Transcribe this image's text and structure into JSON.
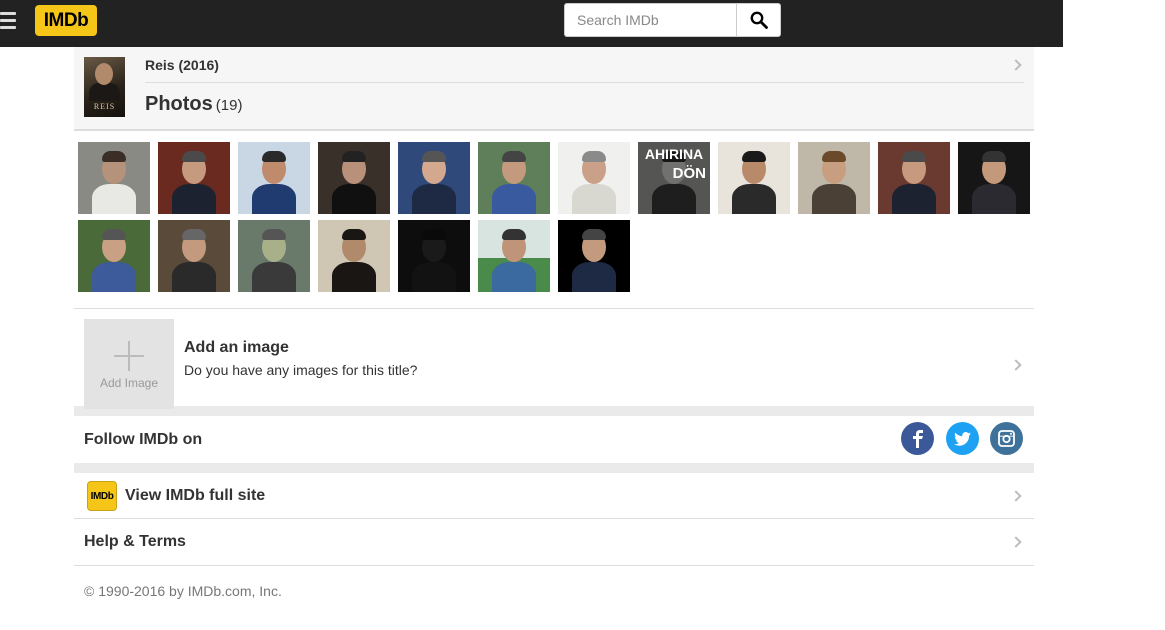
{
  "header": {
    "logo_text": "IMDb",
    "search_placeholder": "Search IMDb",
    "menu_icon": "hamburger-menu-icon",
    "search_icon": "search-icon"
  },
  "title": {
    "name": "Reis (2016)",
    "section": "Photos",
    "count": "(19)",
    "poster_text": "REIS"
  },
  "photos": [
    {
      "bg": "#8a8a85",
      "skin": "#b5927a",
      "cloth": "#e8e8e4",
      "hair": "#3a2e26"
    },
    {
      "bg": "#6a2a20",
      "skin": "#c59a7e",
      "cloth": "#1d2230",
      "hair": "#4a4a4a"
    },
    {
      "bg": "#c9d6e4",
      "skin": "#c08a6c",
      "cloth": "#1f3b70",
      "hair": "#2a2a2a"
    },
    {
      "bg": "#3a302a",
      "skin": "#b9907a",
      "cloth": "#101010",
      "hair": "#222222"
    },
    {
      "bg": "#2f4a7a",
      "skin": "#d3a88e",
      "cloth": "#1e2a44",
      "hair": "#555555"
    },
    {
      "bg": "#5f7f5a",
      "skin": "#c49a7e",
      "cloth": "#3a5aa0",
      "hair": "#444444"
    },
    {
      "bg": "#f0f0ee",
      "skin": "#caa088",
      "cloth": "#d8d8d0",
      "hair": "#8a8a8a"
    },
    {
      "bg": "#9a9a98",
      "skin": "#d8d8d6",
      "cloth": "#202020",
      "hair": "#111111",
      "text": "AHIRINA DÖN"
    },
    {
      "bg": "#e8e4dc",
      "skin": "#b88a6a",
      "cloth": "#2a2a2a",
      "hair": "#1a1a1a"
    },
    {
      "bg": "#bfb8a8",
      "skin": "#c89e80",
      "cloth": "#4a4036",
      "hair": "#6a4a2a"
    },
    {
      "bg": "#6a3a30",
      "skin": "#c59a7e",
      "cloth": "#1d2230",
      "hair": "#4a4a4a"
    },
    {
      "bg": "#161616",
      "skin": "#c4987a",
      "cloth": "#2a2a30",
      "hair": "#333333"
    },
    {
      "bg": "#4a6a3a",
      "skin": "#c9a084",
      "cloth": "#3d5a9a",
      "hair": "#555555"
    },
    {
      "bg": "#5a4a3a",
      "skin": "#c49a7e",
      "cloth": "#2a2a2a",
      "hair": "#666666"
    },
    {
      "bg": "#6a7a6a",
      "skin": "#a8b08a",
      "cloth": "#3a3a3a",
      "hair": "#555555"
    },
    {
      "bg": "#cfc6b4",
      "skin": "#b08a6a",
      "cloth": "#1a1614",
      "hair": "#1a1614"
    },
    {
      "bg": "#0d0d0d",
      "skin": "#1a1a1a",
      "cloth": "#121212",
      "hair": "#0a0a0a"
    },
    {
      "bg": "#d8e4e0",
      "skin": "#c09478",
      "cloth": "#3a6aa0",
      "hair": "#333333",
      "field": "#4a8a4a"
    },
    {
      "bg": "#000000",
      "skin": "#c49a7e",
      "cloth": "#1e2a44",
      "hair": "#444444"
    }
  ],
  "add_image": {
    "box_label": "Add Image",
    "title": "Add an image",
    "subtitle": "Do you have any images for this title?"
  },
  "follow": {
    "label": "Follow IMDb on",
    "facebook_color": "#3b5998",
    "twitter_color": "#1da1f2",
    "instagram_color": "#3f729b"
  },
  "fullsite": {
    "logo_text": "IMDb",
    "label": "View IMDb full site"
  },
  "help": {
    "label": "Help & Terms"
  },
  "footer": {
    "copyright": "© 1990-2016 by IMDb.com, Inc."
  }
}
